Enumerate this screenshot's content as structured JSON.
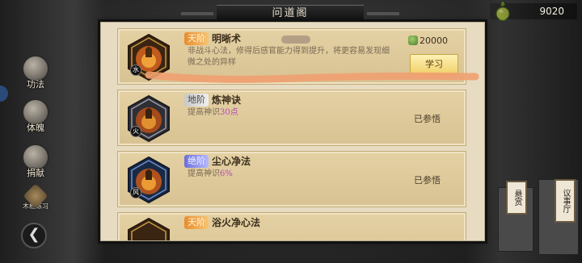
{
  "header": {
    "title": "问道阁"
  },
  "currency": {
    "amount": "9020",
    "icon": "spirit-gourd-icon"
  },
  "left_nav": {
    "items": [
      {
        "label": "功法",
        "icon": "cultivation-art-icon"
      },
      {
        "label": "体魄",
        "icon": "body-icon"
      },
      {
        "label": "捐献",
        "icon": "donate-icon"
      },
      {
        "label": "木桩练习",
        "icon": "training-dummy-icon"
      }
    ]
  },
  "skills": [
    {
      "grade": "天阶",
      "name": "明晰术",
      "desc": "非战斗心法，修得后感官能力得到提升，将更容易发现细微之处的异样",
      "cost": "20000",
      "action": "学习"
    },
    {
      "grade": "地阶",
      "name": "炼神诀",
      "desc_prefix": "提高神识",
      "desc_value": "30点",
      "status": "已参悟"
    },
    {
      "grade": "绝阶",
      "name": "尘心净法",
      "desc_prefix": "提高神识",
      "desc_value": "6%",
      "status": "已参悟"
    },
    {
      "grade": "天阶",
      "name": "浴火净心法"
    }
  ],
  "right_signs": {
    "left": "悬赏",
    "right": "议事厅"
  },
  "colors": {
    "annotation": "#f0a070",
    "panel": "#e7dcc2",
    "row": "#dcc797",
    "learn_button": "#f4d877"
  }
}
